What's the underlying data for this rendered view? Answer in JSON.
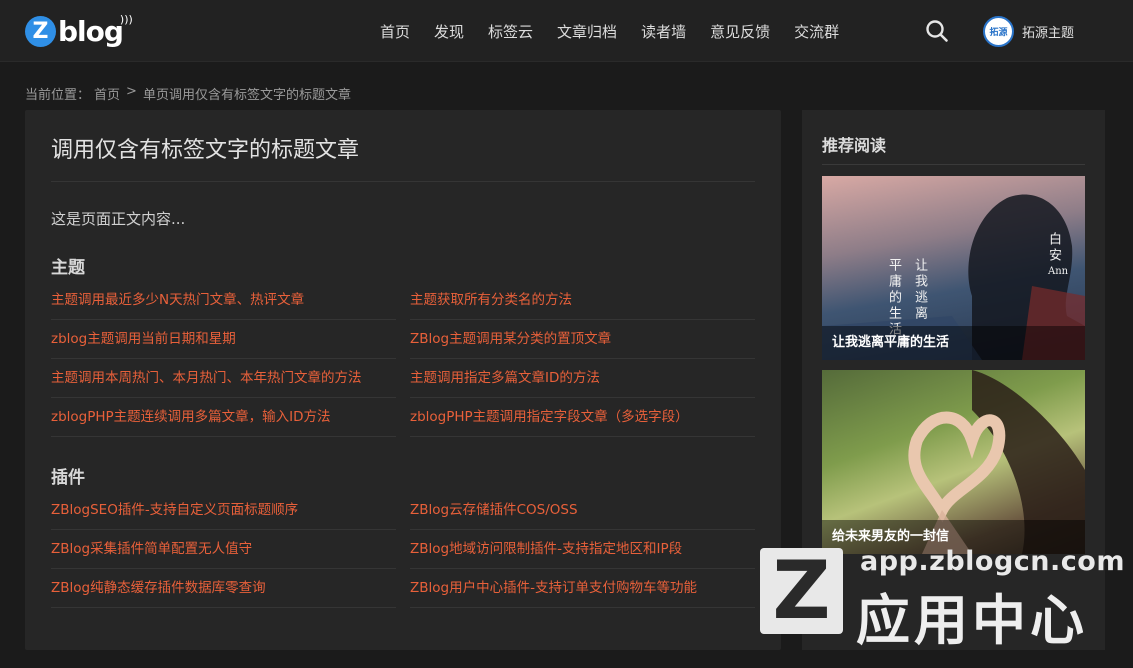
{
  "header": {
    "logo_badge": "Z",
    "logo_text": "blog",
    "nav": [
      "首页",
      "发现",
      "标签云",
      "文章归档",
      "读者墙",
      "意见反馈",
      "交流群"
    ],
    "avatar_text": "拓源",
    "user_name": "拓源主题"
  },
  "breadcrumb": {
    "label": "当前位置：",
    "home": "首页",
    "separator": ">",
    "current": "单页调用仅含有标签文字的标题文章"
  },
  "main": {
    "title": "调用仅含有标签文字的标题文章",
    "intro": "这是页面正文内容...",
    "sections": [
      {
        "heading": "主题",
        "links": [
          "主题调用最近多少N天热门文章、热评文章",
          "主题获取所有分类名的方法",
          "zblog主题调用当前日期和星期",
          "ZBlog主题调用某分类的置顶文章",
          "主题调用本周热门、本月热门、本年热门文章的方法",
          "主题调用指定多篇文章ID的方法",
          "zblogPHP主题连续调用多篇文章，输入ID方法",
          "zblogPHP主题调用指定字段文章（多选字段）"
        ]
      },
      {
        "heading": "插件",
        "links": [
          "ZBlogSEO插件-支持自定义页面标题顺序",
          "ZBlog云存储插件COS/OSS",
          "ZBlog采集插件简单配置无人值守",
          "ZBlog地域访问限制插件-支持指定地区和IP段",
          "ZBlog纯静态缓存插件数据库零查询",
          "ZBlog用户中心插件-支持订单支付购物车等功能"
        ]
      }
    ]
  },
  "sidebar": {
    "title": "推荐阅读",
    "cards": [
      {
        "caption": "让我逃离平庸的生活",
        "poem_lines": [
          "白安",
          "让我逃离",
          "平庸的生活"
        ],
        "poem_en": "Ann"
      },
      {
        "caption": "给未来男友的一封信"
      }
    ]
  },
  "watermark": {
    "badge": "Z",
    "url": "app.zblogcn.com",
    "text": "应用中心"
  },
  "colors": {
    "link": "#e8603a",
    "background": "#1b1b1b",
    "panel": "#262626",
    "header": "#222222"
  }
}
